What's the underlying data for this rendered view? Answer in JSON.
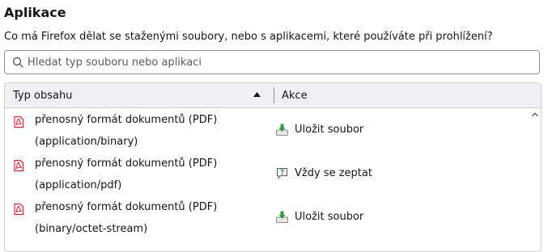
{
  "section": {
    "title": "Aplikace",
    "description": "Co má Firefox dělat se staženými soubory, nebo s aplikacemi, které používáte při prohlížení?"
  },
  "search": {
    "placeholder": "Hledat typ souboru nebo aplikaci",
    "value": "",
    "icon": "search-icon"
  },
  "table": {
    "columns": {
      "type": "Typ obsahu",
      "action": "Akce"
    },
    "sort": "ascending",
    "rows": [
      {
        "type_name": "přenosný formát dokumentů (PDF)",
        "mime": "(application/binary)",
        "action": "Uložit soubor",
        "action_icon": "save-file-icon",
        "type_icon": "pdf-icon"
      },
      {
        "type_name": "přenosný formát dokumentů (PDF)",
        "mime": "(application/pdf)",
        "action": "Vždy se zeptat",
        "action_icon": "always-ask-icon",
        "type_icon": "pdf-icon"
      },
      {
        "type_name": "přenosný formát dokumentů (PDF)",
        "mime": "(binary/octet-stream)",
        "action": "Uložit soubor",
        "action_icon": "save-file-icon",
        "type_icon": "pdf-icon"
      }
    ]
  },
  "colors": {
    "pdf": "#d70022",
    "save": "#2a9d3b",
    "header_bg": "#f0f0f4",
    "border": "#cfcfd8"
  }
}
